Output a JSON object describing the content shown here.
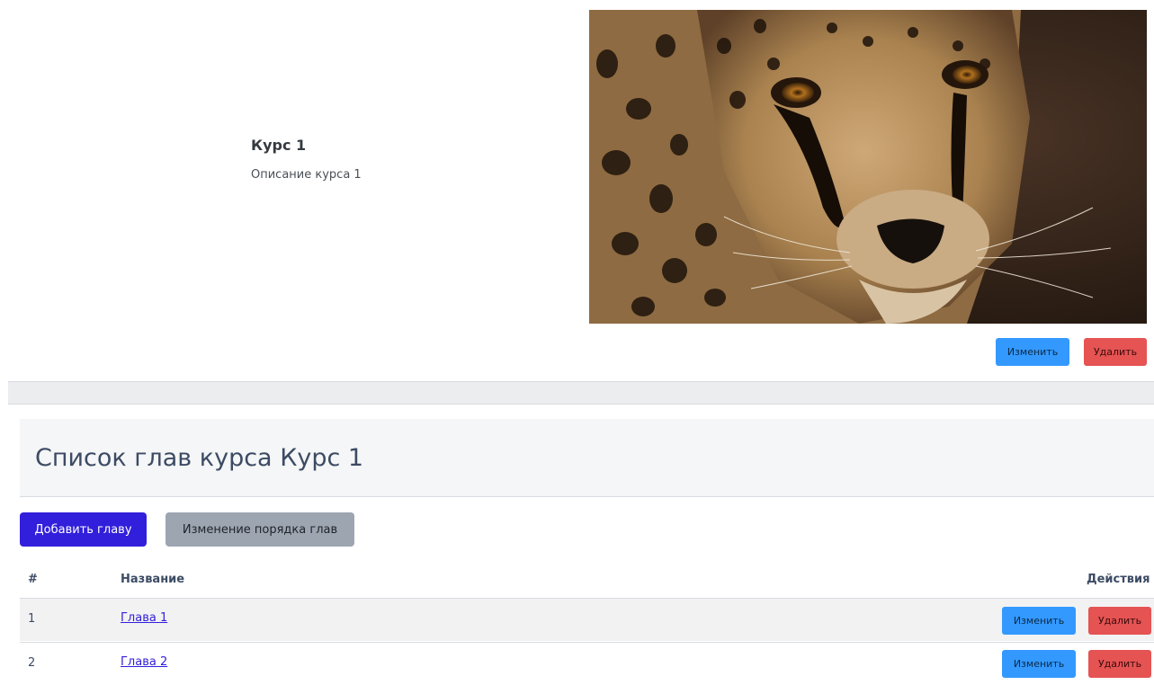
{
  "course": {
    "title": "Курс 1",
    "description": "Описание курса 1",
    "image_alt": "cheetah-photo",
    "edit_label": "Изменить",
    "delete_label": "Удалить"
  },
  "chapters_section": {
    "heading": "Список глав курса Курс 1",
    "add_button": "Добавить главу",
    "reorder_button": "Изменение порядка глав",
    "columns": {
      "num": "#",
      "name": "Название",
      "actions": "Действия"
    },
    "rows": [
      {
        "num": "1",
        "name": "Глава 1",
        "edit": "Изменить",
        "delete": "Удалить"
      },
      {
        "num": "2",
        "name": "Глава 2",
        "edit": "Изменить",
        "delete": "Удалить"
      }
    ]
  },
  "colors": {
    "primary": "#321fdb",
    "info": "#3399ff",
    "danger": "#e55353",
    "secondary": "#9da5b1"
  }
}
